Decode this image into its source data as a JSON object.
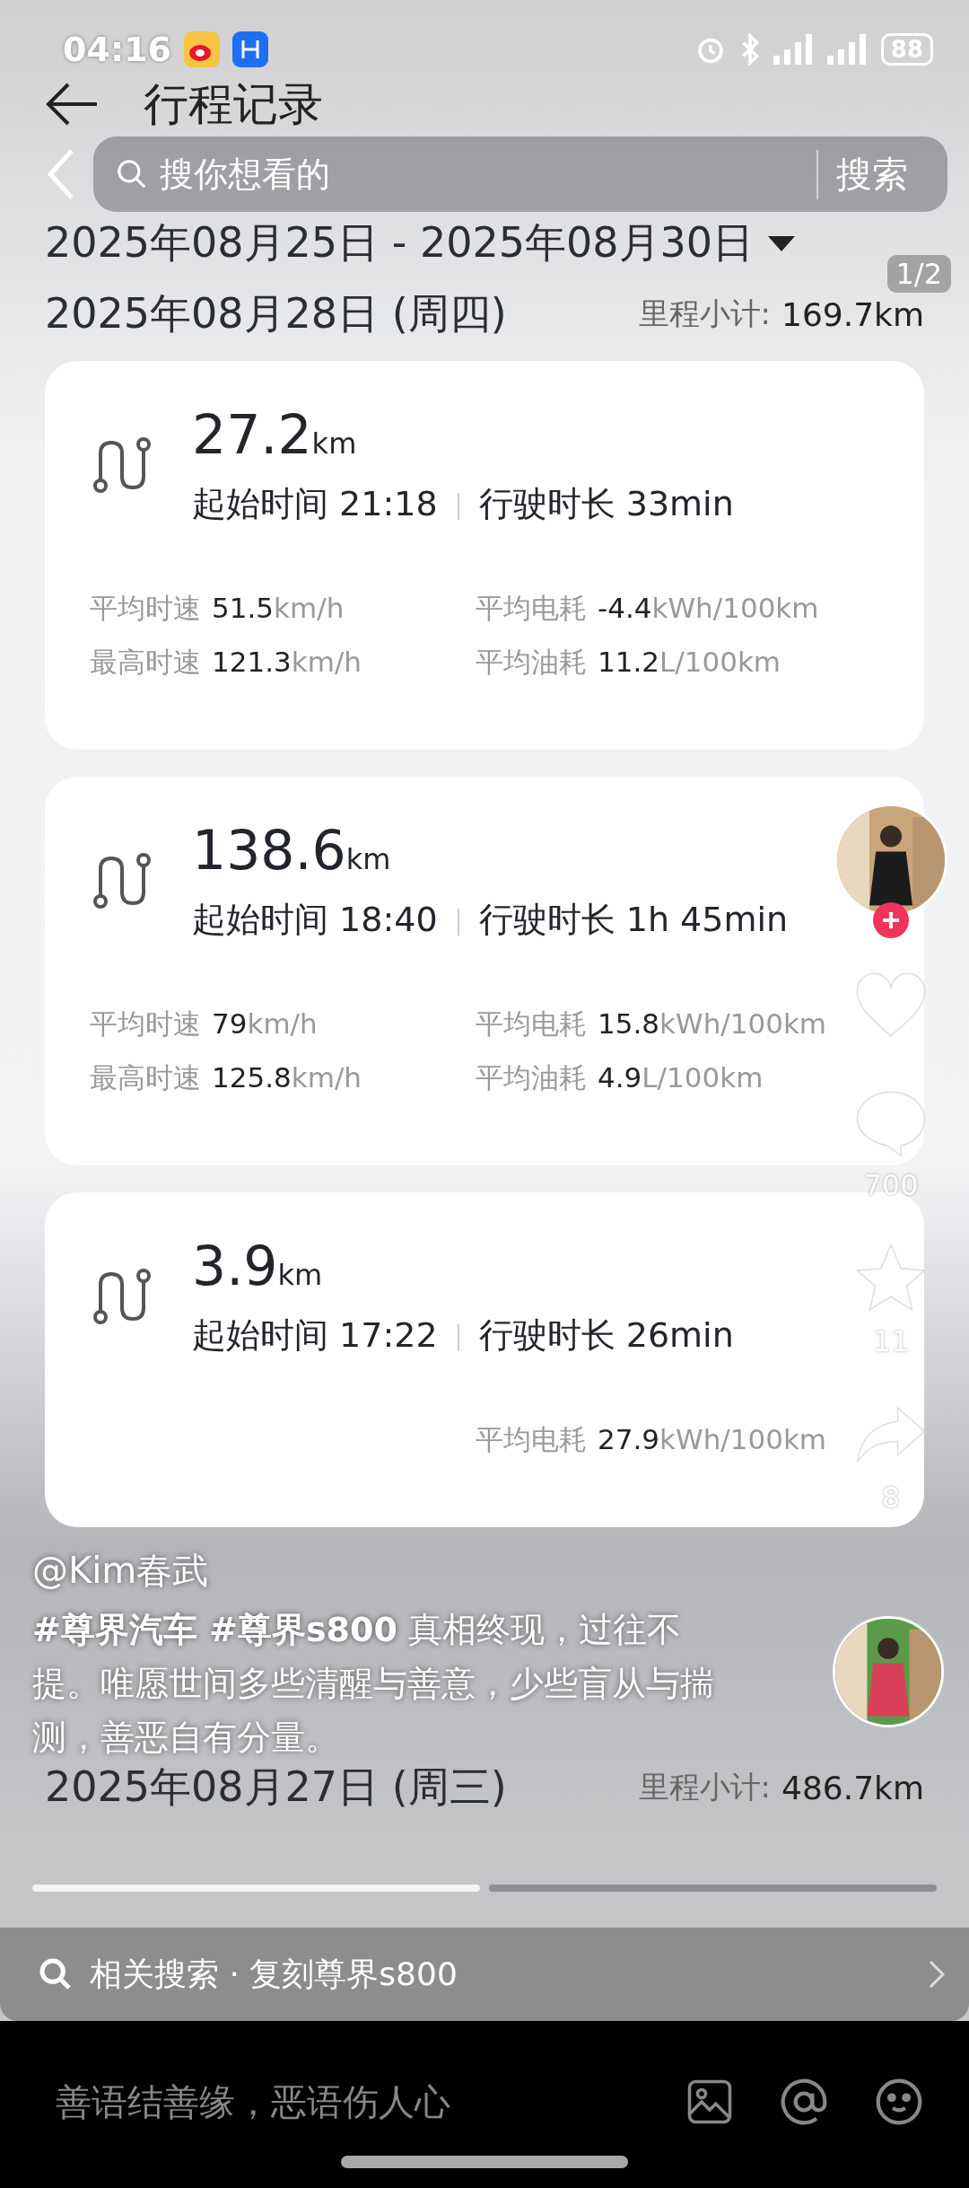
{
  "status_bar": {
    "time": "04:16",
    "battery": "88"
  },
  "header": {
    "title": "行程记录"
  },
  "search": {
    "placeholder": "搜你想看的",
    "button": "搜索"
  },
  "date_range": "2025年08月25日 - 2025年08月30日",
  "page_badge": "1/2",
  "days": [
    {
      "date": "2025年08月28日 (周四)",
      "subtotal_label": "里程小计:",
      "subtotal": "169.7km",
      "trips": [
        {
          "distance": "27.2",
          "unit": "km",
          "start_label": "起始时间",
          "start": "21:18",
          "duration_label": "行驶时长",
          "duration": "33min",
          "left_stats": [
            {
              "label": "平均时速",
              "value": "51.5",
              "unit": "km/h"
            },
            {
              "label": "最高时速",
              "value": "121.3",
              "unit": "km/h"
            }
          ],
          "right_stats": [
            {
              "label": "平均电耗",
              "value": "-4.4",
              "unit": "kWh/100km"
            },
            {
              "label": "平均油耗",
              "value": "11.2",
              "unit": "L/100km"
            }
          ]
        },
        {
          "distance": "138.6",
          "unit": "km",
          "start_label": "起始时间",
          "start": "18:40",
          "duration_label": "行驶时长",
          "duration": "1h 45min",
          "left_stats": [
            {
              "label": "平均时速",
              "value": "79",
              "unit": "km/h"
            },
            {
              "label": "最高时速",
              "value": "125.8",
              "unit": "km/h"
            }
          ],
          "right_stats": [
            {
              "label": "平均电耗",
              "value": "15.8",
              "unit": "kWh/100km"
            },
            {
              "label": "平均油耗",
              "value": "4.9",
              "unit": "L/100km"
            }
          ]
        },
        {
          "distance": "3.9",
          "unit": "km",
          "start_label": "起始时间",
          "start": "17:22",
          "duration_label": "行驶时长",
          "duration": "26min",
          "right_stats": [
            {
              "label": "平均电耗",
              "value": "27.9",
              "unit": "kWh/100km"
            }
          ]
        }
      ]
    },
    {
      "date": "2025年08月27日 (周三)",
      "subtotal_label": "里程小计:",
      "subtotal": "486.7km"
    }
  ],
  "rail": [
    {
      "kind": "like"
    },
    {
      "kind": "comment",
      "count": "700"
    },
    {
      "kind": "favorite",
      "count": "11"
    },
    {
      "kind": "share",
      "count": "8"
    }
  ],
  "caption": {
    "author": "@Kim春武",
    "text": "**#尊界汽车 #尊界s800** 真相终现，过往不提。唯愿世间多些清醒与善意，少些盲从与揣测，善恶自有分量。"
  },
  "segments": [
    {
      "selected": true
    },
    {
      "selected": false
    }
  ],
  "related_search": {
    "text": "相关搜索 · 复刻尊界s800"
  },
  "comment_bar": {
    "placeholder": "善语结善缘，恶语伤人心"
  }
}
